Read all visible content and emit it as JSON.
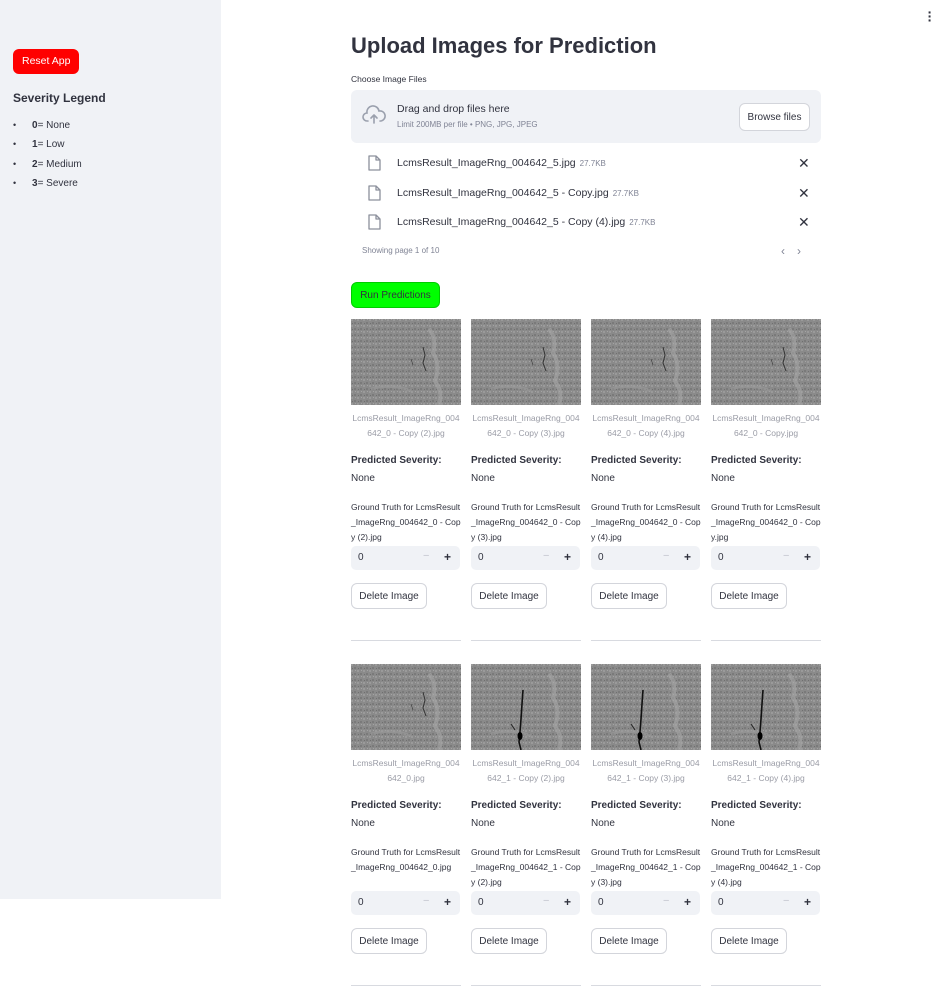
{
  "sidebar": {
    "reset_label": "Reset App",
    "legend_title": "Severity Legend",
    "legend": [
      {
        "level": "0",
        "desc": " = None"
      },
      {
        "level": "1",
        "desc": " = Low"
      },
      {
        "level": "2",
        "desc": " = Medium"
      },
      {
        "level": "3",
        "desc": " = Severe"
      }
    ]
  },
  "main": {
    "title": "Upload Images for Prediction",
    "uploader_label": "Choose Image Files",
    "dropzone": {
      "main_text": "Drag and drop files here",
      "sub_text": "Limit 200MB per file • PNG, JPG, JPEG",
      "browse_label": "Browse files"
    },
    "files": [
      {
        "name": "LcmsResult_ImageRng_004642_5.jpg",
        "size": "27.7KB"
      },
      {
        "name": "LcmsResult_ImageRng_004642_5 - Copy.jpg",
        "size": "27.7KB"
      },
      {
        "name": "LcmsResult_ImageRng_004642_5 - Copy (4).jpg",
        "size": "27.7KB"
      }
    ],
    "pager_text": "Showing page 1 of 10",
    "run_label": "Run Predictions",
    "pred_label": "Predicted Severity:",
    "delete_label": "Delete Image",
    "cards": [
      {
        "caption": "LcmsResult_ImageRng_004642_0 - Copy (2).jpg",
        "prediction": "None",
        "gt_label": "Ground Truth for LcmsResult_ImageRng_004642_0 - Copy (2).jpg",
        "value": "0",
        "crack": false
      },
      {
        "caption": "LcmsResult_ImageRng_004642_0 - Copy (3).jpg",
        "prediction": "None",
        "gt_label": "Ground Truth for LcmsResult_ImageRng_004642_0 - Copy (3).jpg",
        "value": "0",
        "crack": false
      },
      {
        "caption": "LcmsResult_ImageRng_004642_0 - Copy (4).jpg",
        "prediction": "None",
        "gt_label": "Ground Truth for LcmsResult_ImageRng_004642_0 - Copy (4).jpg",
        "value": "0",
        "crack": false
      },
      {
        "caption": "LcmsResult_ImageRng_004642_0 - Copy.jpg",
        "prediction": "None",
        "gt_label": "Ground Truth for LcmsResult_ImageRng_004642_0 - Copy.jpg",
        "value": "0",
        "crack": false
      },
      {
        "caption": "LcmsResult_ImageRng_004642_0.jpg",
        "prediction": "None",
        "gt_label": "Ground Truth for LcmsResult_ImageRng_004642_0.jpg",
        "value": "0",
        "crack": false
      },
      {
        "caption": "LcmsResult_ImageRng_004642_1 - Copy (2).jpg",
        "prediction": "None",
        "gt_label": "Ground Truth for LcmsResult_ImageRng_004642_1 - Copy (2).jpg",
        "value": "0",
        "crack": true
      },
      {
        "caption": "LcmsResult_ImageRng_004642_1 - Copy (3).jpg",
        "prediction": "None",
        "gt_label": "Ground Truth for LcmsResult_ImageRng_004642_1 - Copy (3).jpg",
        "value": "0",
        "crack": true
      },
      {
        "caption": "LcmsResult_ImageRng_004642_1 - Copy (4).jpg",
        "prediction": "None",
        "gt_label": "Ground Truth for LcmsResult_ImageRng_004642_1 - Copy (4).jpg",
        "value": "0",
        "crack": true
      }
    ]
  },
  "icons": {
    "menu": "vertical-dots-icon",
    "upload": "cloud-upload-icon",
    "file": "file-icon",
    "remove": "close-icon",
    "prev": "chevron-left-icon",
    "next": "chevron-right-icon"
  },
  "colors": {
    "reset_button": "#ff0000",
    "run_button": "#00ff00",
    "sidebar_bg": "#f0f2f6",
    "text": "#31333f",
    "muted": "#808495"
  }
}
